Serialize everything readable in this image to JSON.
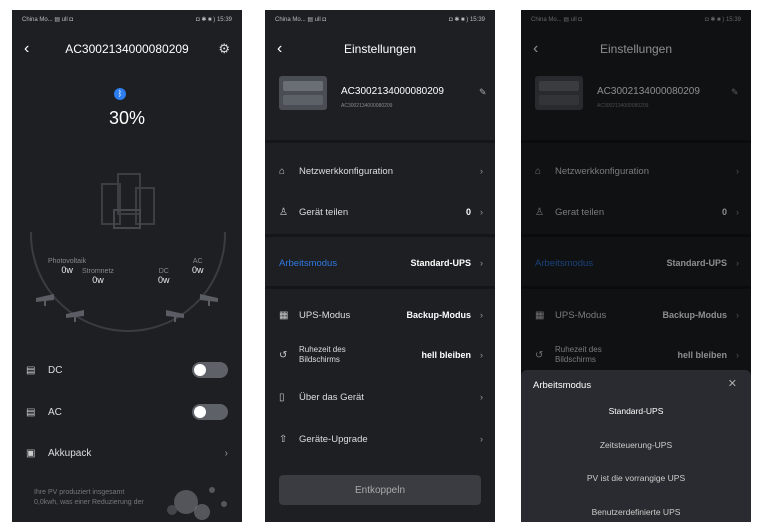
{
  "status_bar": {
    "carrier": "China Mo... ▤ ull ◘",
    "right": "◘ ✱ ■ ) 15:39"
  },
  "screen1": {
    "title": "AC3002134000080209",
    "battery_percent": "30%",
    "flows": [
      {
        "label": "Photovoltaik",
        "value": "0w"
      },
      {
        "label": "Stromnetz",
        "value": "0w"
      },
      {
        "label": "DC",
        "value": "0w"
      },
      {
        "label": "AC",
        "value": "0w"
      }
    ],
    "rows": [
      {
        "label": "DC",
        "toggle": true
      },
      {
        "label": "AC",
        "toggle": true
      },
      {
        "label": "Akkupack",
        "toggle": false
      }
    ],
    "note": "Ihre PV produziert insgesamt 0,0kwh, was einer Reduzierung der"
  },
  "screen2": {
    "title": "Einstellungen",
    "device_name": "AC3002134000080209",
    "device_serial": "AC3002134000080209",
    "items": [
      {
        "label": "Netzwerkkonfiguration",
        "value": ""
      },
      {
        "label": "Gerät teilen",
        "value": "0"
      },
      {
        "label": "Arbeitsmodus",
        "value": "Standard-UPS"
      },
      {
        "label": "UPS-Modus",
        "value": "Backup-Modus"
      },
      {
        "label": "Ruhezeit des Bildschirms",
        "value": "hell bleiben"
      },
      {
        "label": "Über das Gerät",
        "value": ""
      },
      {
        "label": "Geräte-Upgrade",
        "value": ""
      }
    ],
    "disconnect": "Entkoppeln"
  },
  "screen3": {
    "title": "Einstellungen",
    "device_name": "AC3002134000080209",
    "device_serial": "AC3002134000080209",
    "items": [
      {
        "label": "Netzwerkkonfiguration",
        "value": ""
      },
      {
        "label": "Gerat teilen",
        "value": "0"
      },
      {
        "label": "Arbeitsmodus",
        "value": "Standard-UPS"
      },
      {
        "label": "UPS-Modus",
        "value": "Backup-Modus"
      },
      {
        "label": "Ruhezeit des Bildschirms",
        "value": "hell bleiben"
      }
    ],
    "sheet_title": "Arbeitsmodus",
    "options": [
      "Standard-UPS",
      "Zeitsteuerung-UPS",
      "PV ist die vorrangige UPS",
      "Benutzerdefinierte UPS"
    ]
  },
  "colors": {
    "background": "#1e1f23",
    "accent": "#2f78e0",
    "bluetooth": "#2b7df0"
  }
}
